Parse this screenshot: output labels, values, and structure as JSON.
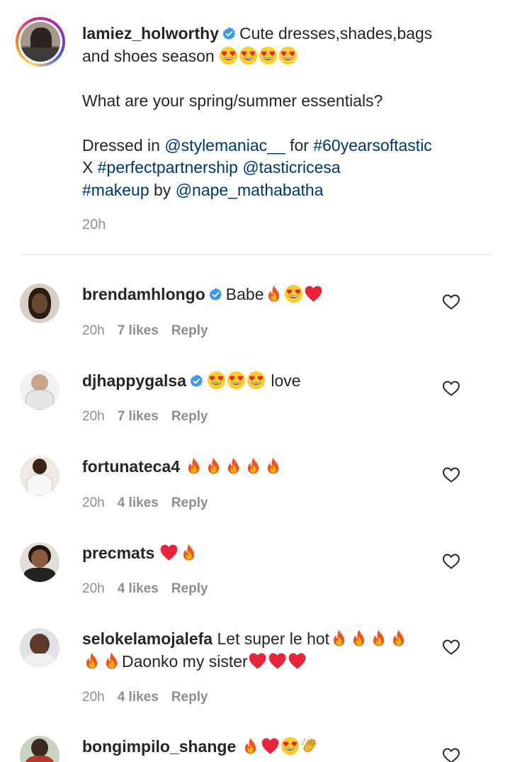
{
  "post_caption": {
    "username": "lamiez_holworthy",
    "line1_text": "Cute dresses,shades,bags",
    "line2_text": "and shoes season",
    "line2_emojis": [
      "heart-eyes-emoji",
      "heart-eyes-emoji",
      "heart-eyes-emoji",
      "heart-eyes-emoji"
    ],
    "question": "What are your spring/summer essentials?",
    "dressed_in": "Dressed in",
    "mention_1": "@stylemaniac__",
    "for_text": "for",
    "hashtag_1": "#60yearsoftastic",
    "x_text": "X",
    "hashtag_2": "#perfectpartnership",
    "mention_2": "@tasticricesa",
    "hashtag_3": "#makeup",
    "by_text": "by",
    "mention_3": "@nape_mathabatha",
    "time": "20h"
  },
  "comments": [
    {
      "username": "brendamhlongo",
      "verified": true,
      "text": "Babe",
      "emojis": [
        "fire-emoji",
        "heart-eyes-emoji",
        "red-heart-emoji"
      ],
      "time": "20h",
      "likes": "7 likes",
      "reply": "Reply"
    },
    {
      "username": "djhappygalsa",
      "verified": true,
      "emojis_before": [
        "heart-eyes-emoji",
        "heart-eyes-emoji",
        "heart-eyes-emoji"
      ],
      "text": "love",
      "time": "20h",
      "likes": "7 likes",
      "reply": "Reply"
    },
    {
      "username": "fortunateca4",
      "verified": false,
      "emojis": [
        "fire-emoji",
        "fire-emoji",
        "fire-emoji",
        "fire-emoji",
        "fire-emoji"
      ],
      "time": "20h",
      "likes": "4 likes",
      "reply": "Reply"
    },
    {
      "username": "precmats",
      "verified": false,
      "emojis": [
        "red-heart-emoji",
        "fire-emoji"
      ],
      "time": "20h",
      "likes": "4 likes",
      "reply": "Reply"
    },
    {
      "username": "selokelamojalefa",
      "verified": false,
      "text": "Let super le hot",
      "text2": "Daonko my sister",
      "time": "20h",
      "likes": "4 likes",
      "reply": "Reply"
    },
    {
      "username": "bongimpilo_shange",
      "verified": false,
      "emojis": [
        "fire-emoji",
        "red-heart-emoji",
        "heart-eyes-emoji",
        "clapping-hands-emoji"
      ]
    }
  ],
  "colors": {
    "text": "#262626",
    "link": "#00376b",
    "muted": "#8e8e8e",
    "verified": "#3897f0",
    "divider": "#e6e6e6"
  }
}
